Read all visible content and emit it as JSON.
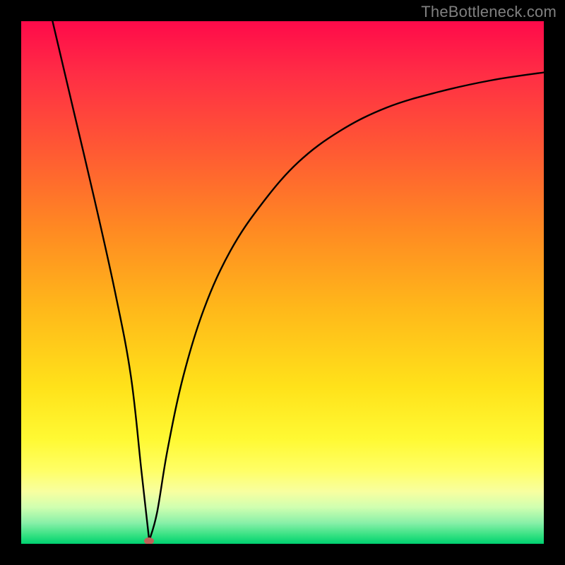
{
  "watermark": "TheBottleneck.com",
  "marker": {
    "color": "#c06058",
    "x_frac": 0.245,
    "y_frac": 0.994
  },
  "gradient_stops": [
    {
      "offset": 0.0,
      "color": "#ff0a4a"
    },
    {
      "offset": 0.1,
      "color": "#ff2d45"
    },
    {
      "offset": 0.25,
      "color": "#ff5a33"
    },
    {
      "offset": 0.4,
      "color": "#ff8a22"
    },
    {
      "offset": 0.55,
      "color": "#ffb81a"
    },
    {
      "offset": 0.7,
      "color": "#ffe21a"
    },
    {
      "offset": 0.8,
      "color": "#fff933"
    },
    {
      "offset": 0.86,
      "color": "#ffff66"
    },
    {
      "offset": 0.9,
      "color": "#f8ffa0"
    },
    {
      "offset": 0.93,
      "color": "#d0ffb0"
    },
    {
      "offset": 0.96,
      "color": "#88f0a8"
    },
    {
      "offset": 0.985,
      "color": "#30e080"
    },
    {
      "offset": 1.0,
      "color": "#00d070"
    }
  ],
  "chart_data": {
    "type": "line",
    "title": "",
    "xlabel": "",
    "ylabel": "",
    "xlim": [
      0,
      100
    ],
    "ylim": [
      0,
      100
    ],
    "grid": false,
    "legend": false,
    "note": "Values are fractions of plot area; y is bottleneck-like metric (0 at bottom, ~100 at top). Curve has a sharp V minimum near x≈24 then rises asymptotically.",
    "series": [
      {
        "name": "curve",
        "x": [
          6,
          10,
          14,
          18,
          21,
          23,
          24.5,
          26,
          28,
          31,
          35,
          40,
          46,
          53,
          61,
          70,
          80,
          90,
          100
        ],
        "y": [
          100,
          83,
          66,
          48,
          32,
          14,
          0.6,
          6,
          18,
          32,
          45,
          56,
          65,
          73,
          79,
          83.5,
          86.5,
          88.7,
          90.2
        ]
      }
    ],
    "marker_point": {
      "x": 24.5,
      "y": 0.6
    }
  }
}
